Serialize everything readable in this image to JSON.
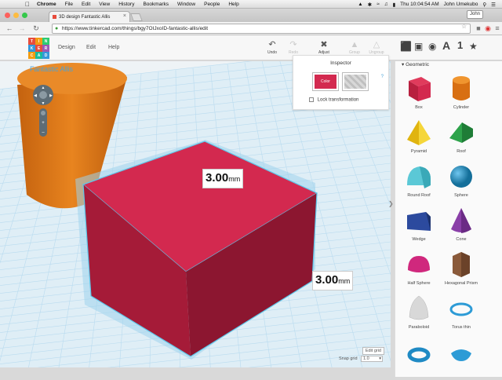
{
  "menubar": {
    "app": "Chrome",
    "items": [
      "File",
      "Edit",
      "View",
      "History",
      "Bookmarks",
      "Window",
      "People",
      "Help"
    ],
    "clock": "Thu 10:04:54 AM",
    "user": "John Umekubo"
  },
  "browser": {
    "tab_title": "3D design Fantastic Allis",
    "url": "https://www.tinkercad.com/things/bgy7OIJxoID-fantastic-allis/edit",
    "profile_label": "John"
  },
  "app": {
    "logo_letters": [
      "T",
      "I",
      "N",
      "K",
      "E",
      "R",
      "C",
      "A",
      "D"
    ],
    "menu": [
      "Design",
      "Edit",
      "Help"
    ],
    "toolbar": [
      {
        "label": "Undo",
        "icon": "undo-icon",
        "enabled": true
      },
      {
        "label": "Redo",
        "icon": "redo-icon",
        "enabled": false
      },
      {
        "label": "Adjust",
        "icon": "adjust-icon",
        "enabled": true
      },
      {
        "label": "Group",
        "icon": "group-icon",
        "enabled": false
      },
      {
        "label": "Ungroup",
        "icon": "ungroup-icon",
        "enabled": false
      }
    ],
    "view_icons": [
      "wireframe-cube-icon",
      "solid-cube-icon",
      "ball-icon",
      "text-a-icon",
      "number-1-icon",
      "star-icon"
    ],
    "view_glyphs": [
      "A",
      "1"
    ],
    "design_title": "Fantastic Allis"
  },
  "inspector": {
    "title": "Inspector",
    "color_label": "Color",
    "help": "?",
    "lock_label": "Lock transformation",
    "color": "#d3294f"
  },
  "dimensions": {
    "length": {
      "value": "3.00",
      "unit": "mm"
    },
    "width": {
      "value": "3.00",
      "unit": "mm"
    }
  },
  "snap": {
    "edit_grid": "Edit grid",
    "snap_label": "Snap grid",
    "snap_value": "1.0"
  },
  "shapes_panel": {
    "category": "Geometric",
    "shapes": [
      {
        "label": "Box",
        "color": "#d3294f"
      },
      {
        "label": "Cylinder",
        "color": "#e87f1f"
      },
      {
        "label": "Pyramid",
        "color": "#f2cf1e"
      },
      {
        "label": "Roof",
        "color": "#2ea34b"
      },
      {
        "label": "Round Roof",
        "color": "#5bc8d6"
      },
      {
        "label": "Sphere",
        "color": "#1f96c8"
      },
      {
        "label": "Wedge",
        "color": "#2c4a9e"
      },
      {
        "label": "Cone",
        "color": "#8a3fa8"
      },
      {
        "label": "Half Sphere",
        "color": "#d0287d"
      },
      {
        "label": "Hexagonal Prism",
        "color": "#8a5a3a"
      },
      {
        "label": "Paraboloid",
        "color": "#d8d8d8"
      },
      {
        "label": "Torus thin",
        "color": "#2d9bd6"
      }
    ]
  },
  "colors": {
    "accent": "#4aa3d8",
    "box_front": "#b8203f",
    "box_top": "#d3294f",
    "cylinder": "#e07a1e",
    "grid_line": "#b9dbef"
  }
}
